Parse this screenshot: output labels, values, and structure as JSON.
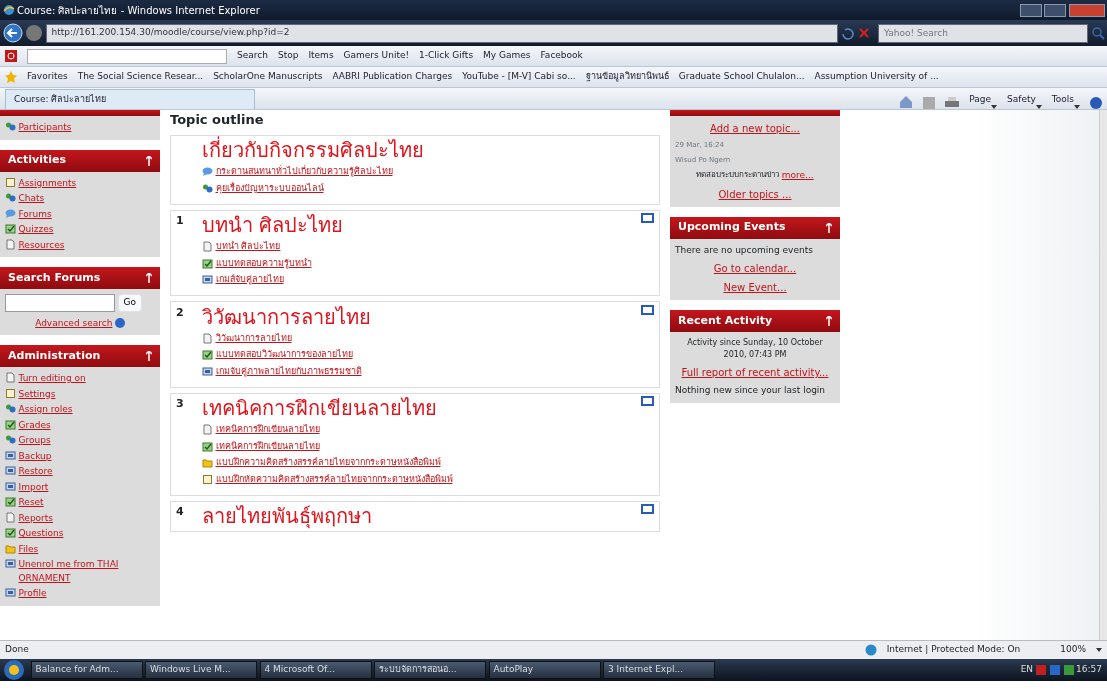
{
  "window": {
    "title": "Course: ศิลปะลายไทย - Windows Internet Explorer"
  },
  "address_bar": {
    "url": "http://161.200.154.30/moodle/course/view.php?id=2"
  },
  "search_box": {
    "placeholder": "Yahoo! Search"
  },
  "toolbar": {
    "items": [
      "Search",
      "Stop",
      "Items",
      "Gamers Unite!",
      "1-Click Gifts",
      "My Games",
      "Facebook"
    ]
  },
  "favorites": [
    "Favorites",
    "The Social Science Resear...",
    "ScholarOne Manuscripts",
    "AABRI Publication Charges",
    "YouTube - [M-V] Cabi so...",
    "ฐานข้อมูลวิทยานิพนธ์",
    "Graduate School Chulalon...",
    "Assumption University of ..."
  ],
  "tab": {
    "label": "Course: ศิลปะลายไทย",
    "selected": true
  },
  "command_bar": [
    "Page",
    "Safety",
    "Tools"
  ],
  "left_blocks": [
    {
      "kind": "links",
      "items": [
        {
          "label": "Participants",
          "kind": "people"
        }
      ]
    },
    {
      "kind": "links",
      "title": "Activities",
      "items": [
        {
          "label": "Assignments",
          "kind": "box"
        },
        {
          "label": "Chats",
          "kind": "people"
        },
        {
          "label": "Forums",
          "kind": "bubble"
        },
        {
          "label": "Quizzes",
          "kind": "check"
        },
        {
          "label": "Resources",
          "kind": "doc"
        }
      ]
    },
    {
      "kind": "search",
      "title": "Search Forums",
      "button": "Go",
      "link": "Advanced search"
    },
    {
      "kind": "links",
      "title": "Administration",
      "items": [
        {
          "label": "Turn editing on",
          "kind": "doc"
        },
        {
          "label": "Settings",
          "kind": "box"
        },
        {
          "label": "Assign roles",
          "kind": "people"
        },
        {
          "label": "Grades",
          "kind": "check"
        },
        {
          "label": "Groups",
          "kind": "people"
        },
        {
          "label": "Backup",
          "kind": "card"
        },
        {
          "label": "Restore",
          "kind": "card"
        },
        {
          "label": "Import",
          "kind": "card"
        },
        {
          "label": "Reset",
          "kind": "check"
        },
        {
          "label": "Reports",
          "kind": "doc"
        },
        {
          "label": "Questions",
          "kind": "check"
        },
        {
          "label": "Files",
          "kind": "folder"
        },
        {
          "label": "Unenrol me from THAI ORNAMENT",
          "kind": "card"
        },
        {
          "label": "Profile",
          "kind": "card"
        }
      ]
    }
  ],
  "main": {
    "heading": "Topic outline",
    "sections": [
      {
        "title": "เกี่ยวกับกิจกรรมศิลปะไทย",
        "items": [
          {
            "label": "กระดานสนทนาทั่วไปเกี่ยวกับความรู้ศิลปะไทย",
            "kind": "bubble"
          },
          {
            "label": "คุยเรื่องปัญหาระบบออนไลน์",
            "kind": "people"
          }
        ]
      },
      {
        "number": "1",
        "title": "บทนำ ศิลปะไทย",
        "items": [
          {
            "label": "บทนำ ศิลปะไทย",
            "kind": "doc"
          },
          {
            "label": "แบบทดสอบความรู้บทนำ",
            "kind": "check"
          },
          {
            "label": "เกมส์จับคู่ลายไทย",
            "kind": "card"
          }
        ]
      },
      {
        "number": "2",
        "title": "วิวัฒนาการลายไทย",
        "items": [
          {
            "label": "วิวัฒนาการลายไทย",
            "kind": "doc"
          },
          {
            "label": "แบบทดสอบวิวัฒนาการของลายไทย",
            "kind": "check"
          },
          {
            "label": "เกมจับคู่ภาพลายไทยกับภาพธรรมชาติ",
            "kind": "card"
          }
        ]
      },
      {
        "number": "3",
        "title": "เทคนิคการฝึกเขียนลายไทย",
        "items": [
          {
            "label": "เทคนิคการฝึกเขียนลายไทย",
            "kind": "doc"
          },
          {
            "label": "เทคนิคการฝึกเขียนลายไทย",
            "kind": "check"
          },
          {
            "label": "แบบฝึกความคิดสร้างสรรค์ลายไทยจากกระดาษหนังสือพิมพ์",
            "kind": "folder"
          },
          {
            "label": "แบบฝึกหัดความคิดสร้างสรรค์ลายไทยจากกระดาษหนังสือพิมพ์",
            "kind": "box"
          }
        ]
      },
      {
        "number": "4",
        "title": "ลายไทยพันธุ์พฤกษา"
      }
    ]
  },
  "right_blocks": [
    {
      "lines": [
        {
          "kind": "link",
          "text": "Add a new topic..."
        },
        {
          "kind": "small",
          "text": "29 Mar, 16:24"
        },
        {
          "kind": "small",
          "text": "Wisud Po Ngern"
        },
        {
          "kind": "news",
          "text": "ทดสอบระบบกระดานข่าว",
          "link": "more..."
        },
        {
          "kind": "link",
          "text": "Older topics ..."
        }
      ]
    },
    {
      "title": "Upcoming Events",
      "lines": [
        {
          "kind": "text",
          "text": "There are no upcoming events"
        },
        {
          "kind": "link",
          "text": "Go to calendar..."
        },
        {
          "kind": "link",
          "text": "New Event..."
        }
      ]
    },
    {
      "title": "Recent Activity",
      "lines": [
        {
          "kind": "center",
          "text": "Activity since Sunday, 10 October 2010, 07:43 PM"
        },
        {
          "kind": "link",
          "text": "Full report of recent activity..."
        },
        {
          "kind": "text",
          "text": "Nothing new since your last login"
        }
      ]
    }
  ],
  "status_bar": {
    "text": "Done",
    "zone": "Internet | Protected Mode: On",
    "zoom": "100%"
  },
  "taskbar": {
    "tasks": [
      "Balance for Adm...",
      "Windows Live M...",
      "4 Microsoft Of...",
      "ระบบจัดการสอนอ...",
      "AutoPlay",
      "3 Internet Expl..."
    ],
    "language": "EN",
    "clock": "16:57"
  }
}
